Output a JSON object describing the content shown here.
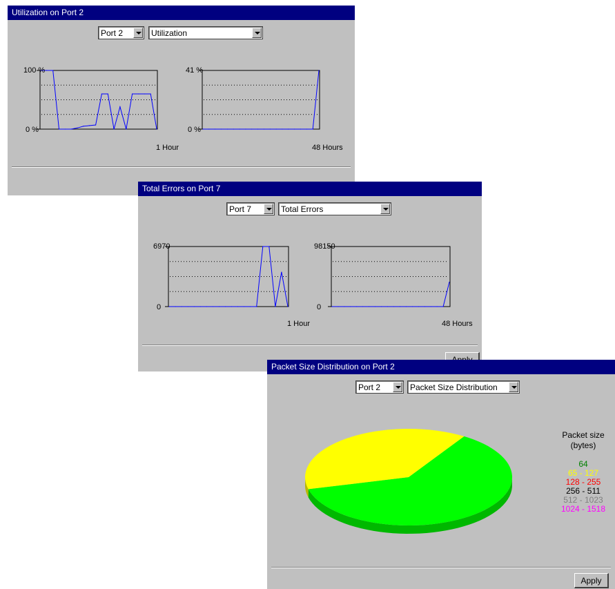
{
  "window1": {
    "title": "Utilization on Port 2",
    "port_select": "Port 2",
    "metric_select": "Utilization",
    "graph_short": {
      "y_max": "100 %",
      "y_min": "0 %",
      "x_label": "1 Hour"
    },
    "graph_long": {
      "y_max": "41 %",
      "y_min": "0 %",
      "x_label": "48 Hours"
    }
  },
  "window2": {
    "title": "Total Errors on Port 7",
    "port_select": "Port 7",
    "metric_select": "Total Errors",
    "graph_short": {
      "y_max": "6970",
      "y_min": "0",
      "x_label": "1 Hour"
    },
    "graph_long": {
      "y_max": "98150",
      "y_min": "0",
      "x_label": "48 Hours"
    },
    "apply_label": "Apply"
  },
  "window3": {
    "title": "Packet Size Distribution on Port 2",
    "port_select": "Port 2",
    "metric_select": "Packet Size Distribution",
    "legend_title": "Packet size\n(bytes)",
    "legend_title_line1": "Packet size",
    "legend_title_line2": "(bytes)",
    "legend": [
      {
        "label": "64",
        "color": "#008000"
      },
      {
        "label": "65 - 127",
        "color": "#ffff00"
      },
      {
        "label": "128 - 255",
        "color": "#ff0000"
      },
      {
        "label": "256 - 511",
        "color": "#000000"
      },
      {
        "label": "512 - 1023",
        "color": "#808080"
      },
      {
        "label": "1024 - 1518",
        "color": "#ff00ff"
      }
    ],
    "apply_label": "Apply"
  },
  "chart_data": [
    {
      "type": "line",
      "title": "Utilization on Port 2 - 1 Hour",
      "ylim": [
        0,
        100
      ],
      "series": [
        {
          "values": [
            100,
            100,
            100,
            0,
            0,
            0,
            2,
            5,
            6,
            7,
            60,
            60,
            0,
            38,
            0,
            60,
            60,
            60,
            60,
            0
          ]
        }
      ]
    },
    {
      "type": "line",
      "title": "Utilization on Port 2 - 48 Hours",
      "ylim": [
        0,
        41
      ],
      "series": [
        {
          "values": [
            0,
            0,
            0,
            0,
            0,
            0,
            0,
            0,
            0,
            0,
            0,
            0,
            0,
            0,
            0,
            0,
            0,
            0,
            0,
            41
          ]
        }
      ]
    },
    {
      "type": "line",
      "title": "Total Errors on Port 7 - 1 Hour",
      "ylim": [
        0,
        6970
      ],
      "series": [
        {
          "values": [
            0,
            0,
            0,
            0,
            0,
            0,
            0,
            0,
            0,
            0,
            0,
            0,
            0,
            0,
            0,
            6970,
            6970,
            0,
            4000,
            0
          ]
        }
      ]
    },
    {
      "type": "line",
      "title": "Total Errors on Port 7 - 48 Hours",
      "ylim": [
        0,
        98150
      ],
      "series": [
        {
          "values": [
            0,
            0,
            0,
            0,
            0,
            0,
            0,
            0,
            0,
            0,
            0,
            0,
            0,
            0,
            0,
            0,
            0,
            0,
            0,
            40000
          ]
        }
      ]
    },
    {
      "type": "pie",
      "title": "Packet Size Distribution on Port 2",
      "categories": [
        "64",
        "65 - 127",
        "128 - 255",
        "256 - 511",
        "512 - 1023",
        "1024 - 1518"
      ],
      "values": [
        62,
        38,
        0,
        0,
        0,
        0
      ],
      "colors": [
        "#00ff00",
        "#ffff00",
        "#ff0000",
        "#000000",
        "#808080",
        "#ff00ff"
      ]
    }
  ]
}
